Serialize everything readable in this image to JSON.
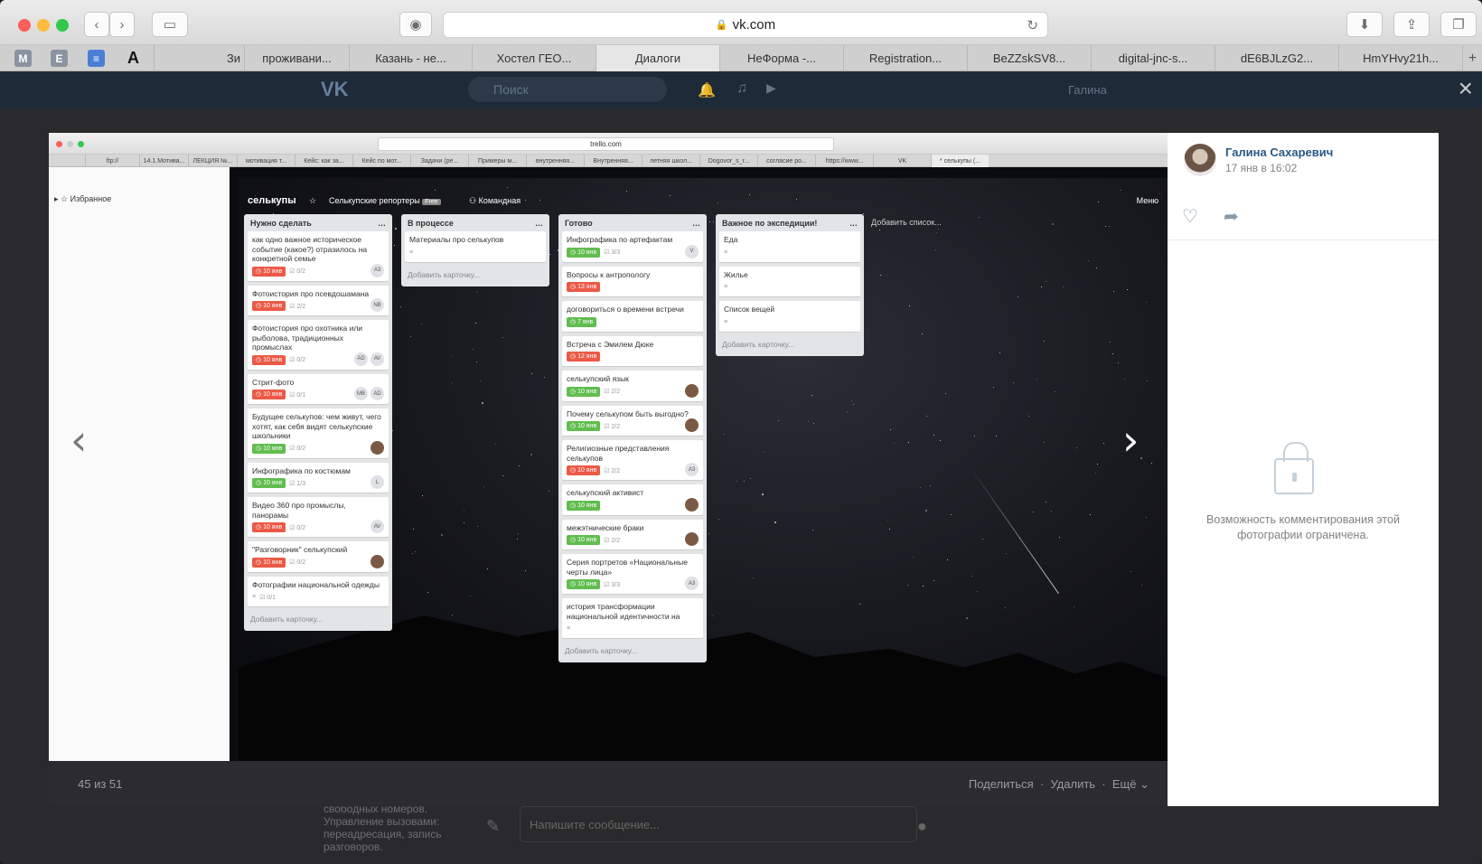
{
  "browser": {
    "url": "vk.com",
    "bookmarks": [
      "M",
      "E",
      "≡",
      "A"
    ],
    "tabs": [
      "Зи",
      "проживани...",
      "Казань - не...",
      "Хостел ГЕО...",
      "Диалоги",
      "НеФорма -...",
      "Registration...",
      "BeZZskSV8...",
      "digital-jnc-s...",
      "dE6BJLzG2...",
      "HmYHvy21h..."
    ],
    "active_tab": 4
  },
  "vk": {
    "search_placeholder": "Поиск",
    "user": "Галина",
    "below_text": "свободных номеров. Управление вызовами: переадресация, запись разговоров.",
    "message_placeholder": "Напишите сообщение..."
  },
  "inner_browser": {
    "url": "trello.com",
    "tabs": [
      "ftp://",
      "14.1.Мотива...",
      "ЛЕКЦИЯ №...",
      "мотивация т...",
      "Кейс: как за...",
      "Кейс по мот...",
      "Задачи (ре...",
      "Примеры м...",
      "внутренняя...",
      "Внутренняя...",
      "летняя школ...",
      "Dogovor_s_r...",
      "согласие ро...",
      "https://www...",
      "VK",
      "* селькупы (..."
    ]
  },
  "trello": {
    "favorites": "Избранное",
    "board_title": "селькупы",
    "team": "Селькупские репортеры",
    "team_badge": "Free",
    "visibility": "Командная",
    "menu": "Меню",
    "add_list": "Добавить список...",
    "add_card": "Добавить карточку...",
    "lists": [
      {
        "title": "Нужно сделать",
        "cards": [
          {
            "title": "как одно важное историческое событие (какое?) отразилось на конкретной семье",
            "due": "10 янв",
            "due_color": "r",
            "check": "0/2",
            "avatars": [
              "A3"
            ]
          },
          {
            "title": "Фотоистория про псевдошамана",
            "due": "10 янв",
            "due_color": "r",
            "check": "2/2",
            "avatars": [
              "NB"
            ]
          },
          {
            "title": "Фотоистория про охотника или рыболова, традиционных промыслах",
            "due": "10 янв",
            "due_color": "r",
            "check": "0/2",
            "avatars": [
              "AV",
              "AD"
            ]
          },
          {
            "title": "Стрит-фото",
            "due": "10 янв",
            "due_color": "r",
            "check": "0/1",
            "avatars": [
              "AD",
              "MB"
            ]
          },
          {
            "title": "Будущее селькупов: чем живут, чего хотят, как себя видят селькупские школьники",
            "due": "10 янв",
            "due_color": "g",
            "check": "0/2",
            "avatars": [
              ""
            ]
          },
          {
            "title": "Инфографика по костюмам",
            "due": "10 янв",
            "due_color": "g",
            "check": "1/3",
            "avatars": [
              "L"
            ]
          },
          {
            "title": "Видео 360 про промыслы, панорамы",
            "due": "10 янв",
            "due_color": "r",
            "check": "0/2",
            "avatars": [
              "AV"
            ]
          },
          {
            "title": "\"Разговорник\" селькупский",
            "due": "10 янв",
            "due_color": "r",
            "check": "0/2",
            "avatars": [
              ""
            ]
          },
          {
            "title": "Фотографии национальной одежды",
            "due": "",
            "due_color": "",
            "check": "0/1",
            "avatars": []
          }
        ]
      },
      {
        "title": "В процессе",
        "cards": [
          {
            "title": "Материалы про селькупов",
            "due": "",
            "due_color": "",
            "check": "",
            "avatars": []
          }
        ]
      },
      {
        "title": "Готово",
        "cards": [
          {
            "title": "Инфографика по артефактам",
            "due": "10 янв",
            "due_color": "g",
            "check": "3/3",
            "avatars": [
              "V"
            ]
          },
          {
            "title": "Вопросы к антропологу",
            "due": "13 янв",
            "due_color": "r",
            "check": "",
            "avatars": []
          },
          {
            "title": "договориться о времени встречи",
            "due": "7 янв",
            "due_color": "g",
            "check": "",
            "avatars": []
          },
          {
            "title": "Встреча с Эмилем Дюке",
            "due": "12 янв",
            "due_color": "r",
            "check": "",
            "avatars": []
          },
          {
            "title": "селькупский язык",
            "due": "10 янв",
            "due_color": "g",
            "check": "2/2",
            "avatars": [
              ""
            ]
          },
          {
            "title": "Почему селькупом быть выгодно?",
            "due": "10 янв",
            "due_color": "g",
            "check": "2/2",
            "avatars": [
              ""
            ]
          },
          {
            "title": "Религиозные представления селькупов",
            "due": "10 янв",
            "due_color": "r",
            "check": "2/2",
            "avatars": [
              "A3"
            ]
          },
          {
            "title": "селькупский активист",
            "due": "10 янв",
            "due_color": "g",
            "check": "",
            "avatars": [
              ""
            ]
          },
          {
            "title": "межэтнические браки",
            "due": "10 янв",
            "due_color": "g",
            "check": "2/2",
            "avatars": [
              ""
            ]
          },
          {
            "title": "Серия портретов «Национальные черты лица»",
            "due": "10 янв",
            "due_color": "g",
            "check": "3/3",
            "avatars": [
              "A3"
            ]
          },
          {
            "title": "история трансформации национальной идентичности на",
            "due": "",
            "due_color": "",
            "check": "",
            "avatars": []
          }
        ]
      },
      {
        "title": "Важное по экспедиции!",
        "cards": [
          {
            "title": "Еда",
            "due": "",
            "due_color": "",
            "check": "",
            "avatars": []
          },
          {
            "title": "Жилье",
            "due": "",
            "due_color": "",
            "check": "",
            "avatars": []
          },
          {
            "title": "Список вещей",
            "due": "",
            "due_color": "",
            "check": "",
            "avatars": []
          }
        ]
      }
    ]
  },
  "viewer": {
    "counter": "45 из 51",
    "share": "Поделиться",
    "delete": "Удалить",
    "more": "Ещё",
    "author": "Галина Сахаревич",
    "date": "17 янв в 16:02",
    "comments_note": "Возможность комментирования этой фотографии ограничена."
  },
  "colors": {
    "accent": "#2a5885",
    "due_red": "#eb5a46",
    "due_green": "#61bd4f"
  }
}
